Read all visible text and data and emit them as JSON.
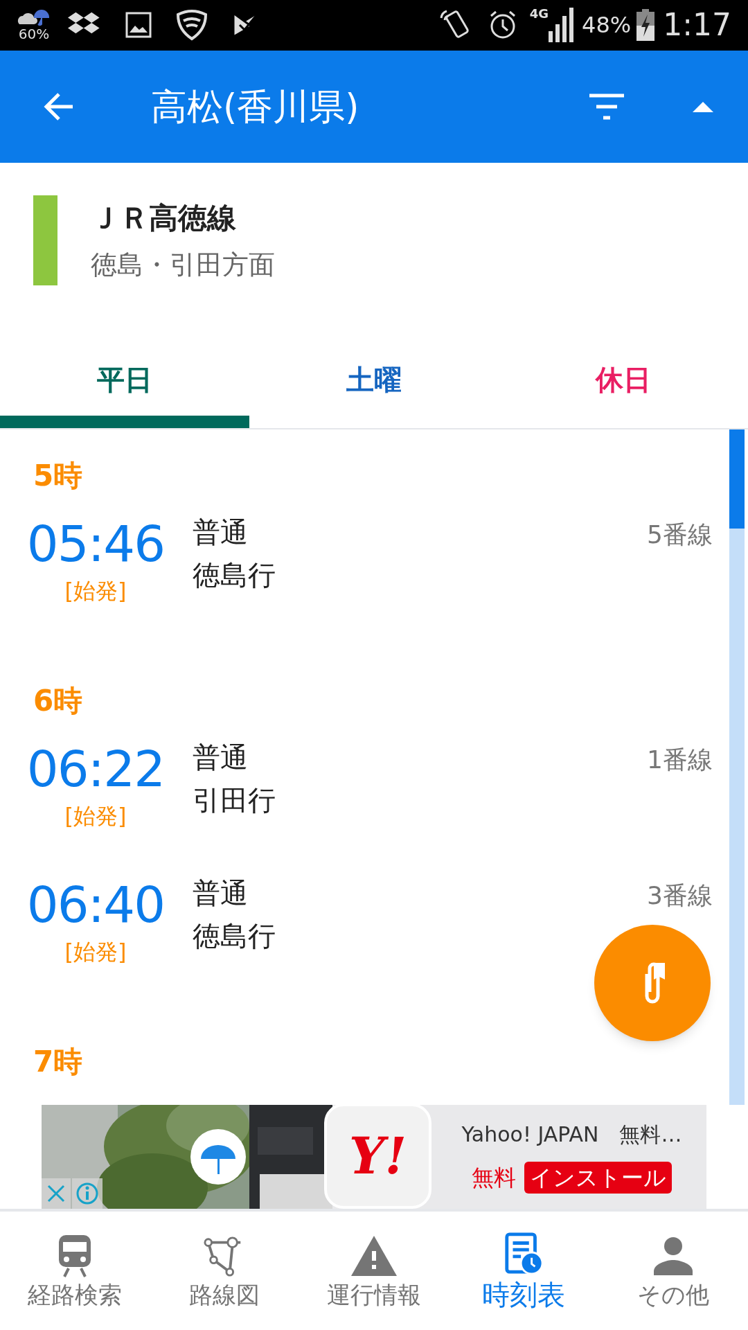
{
  "status_bar": {
    "weather_percent": "60%",
    "network": "4G",
    "battery": "48%",
    "time": "1:17"
  },
  "app_bar": {
    "title": "高松(香川県)"
  },
  "line": {
    "name": "ＪＲ高徳線",
    "direction": "徳島・引田方面",
    "color": "#8dc63f"
  },
  "tabs": [
    {
      "label": "平日",
      "selected": true,
      "color": "#00695c"
    },
    {
      "label": "土曜",
      "selected": false,
      "color": "#1565c0"
    },
    {
      "label": "休日",
      "selected": false,
      "color": "#e91e63"
    }
  ],
  "timetable": [
    {
      "hour": "5時",
      "departures": [
        {
          "time": "05:46",
          "note": "[始発]",
          "type": "普通",
          "destination": "徳島行",
          "platform": "5番線"
        }
      ]
    },
    {
      "hour": "6時",
      "departures": [
        {
          "time": "06:22",
          "note": "[始発]",
          "type": "普通",
          "destination": "引田行",
          "platform": "1番線"
        },
        {
          "time": "06:40",
          "note": "[始発]",
          "type": "普通",
          "destination": "徳島行",
          "platform": "3番線"
        }
      ]
    },
    {
      "hour": "7時"
    }
  ],
  "ad": {
    "logo": "Y!",
    "title": "Yahoo! JAPAN　無料…",
    "price": "無料",
    "install": "インストール"
  },
  "bottom_nav": [
    {
      "label": "経路検索",
      "kind": "train",
      "selected": false
    },
    {
      "label": "路線図",
      "kind": "map",
      "selected": false
    },
    {
      "label": "運行情報",
      "kind": "warning",
      "selected": false
    },
    {
      "label": "時刻表",
      "kind": "timetable",
      "selected": true
    },
    {
      "label": "その他",
      "kind": "person",
      "selected": false
    }
  ]
}
